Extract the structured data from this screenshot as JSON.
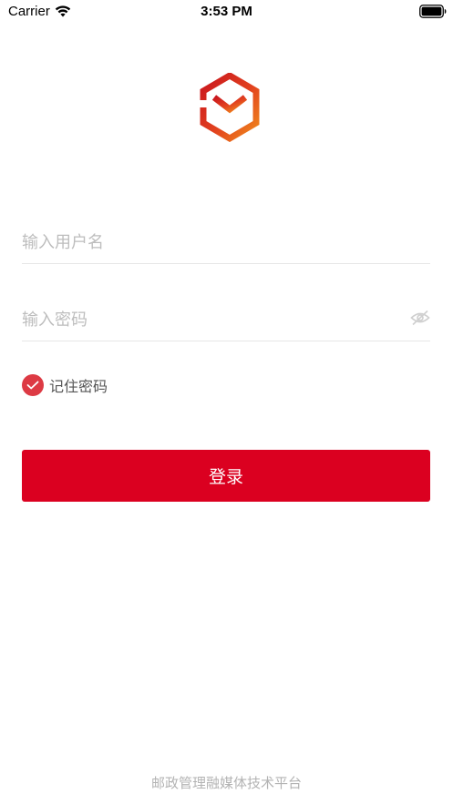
{
  "status_bar": {
    "carrier": "Carrier",
    "time": "3:53 PM",
    "icons": [
      "wifi-icon",
      "battery-icon"
    ]
  },
  "brand": {
    "logo": "logo-icon",
    "colors": {
      "red": "#c9151e",
      "orange": "#f08a1c"
    }
  },
  "form": {
    "username_placeholder": "输入用户名",
    "username_value": "",
    "password_placeholder": "输入密码",
    "password_value": "",
    "password_toggle_icon": "eye-off-icon",
    "remember_label": "记住密码",
    "remember_checked": true,
    "login_label": "登录",
    "accent_color": "#db0020"
  },
  "footer": {
    "text": "邮政管理融媒体技术平台"
  }
}
